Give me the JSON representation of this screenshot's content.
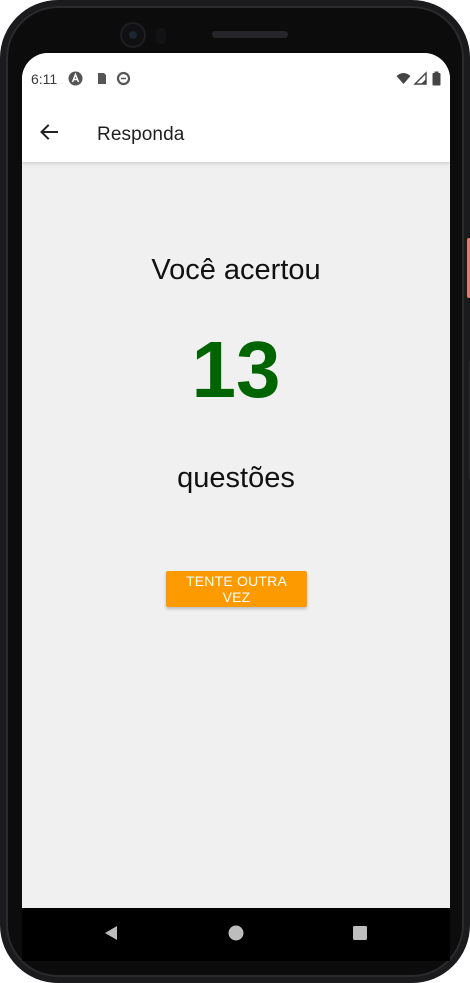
{
  "status_bar": {
    "time": "6:11",
    "left_icons": [
      "android-a-icon",
      "sd-card-icon",
      "data-saver-icon"
    ],
    "right_icons": [
      "wifi-icon",
      "cell-signal-icon",
      "battery-icon"
    ]
  },
  "appbar": {
    "back_icon": "arrow-back-icon",
    "title": "Responda"
  },
  "result": {
    "heading": "Você acertou",
    "score": "13",
    "unit": "questões",
    "score_color": "#006400"
  },
  "actions": {
    "retry_label": "TENTE OUTRA VEZ",
    "retry_color": "#fd9a00"
  },
  "navigation": {
    "buttons": [
      "back-triangle-icon",
      "home-circle-icon",
      "recents-square-icon"
    ]
  }
}
